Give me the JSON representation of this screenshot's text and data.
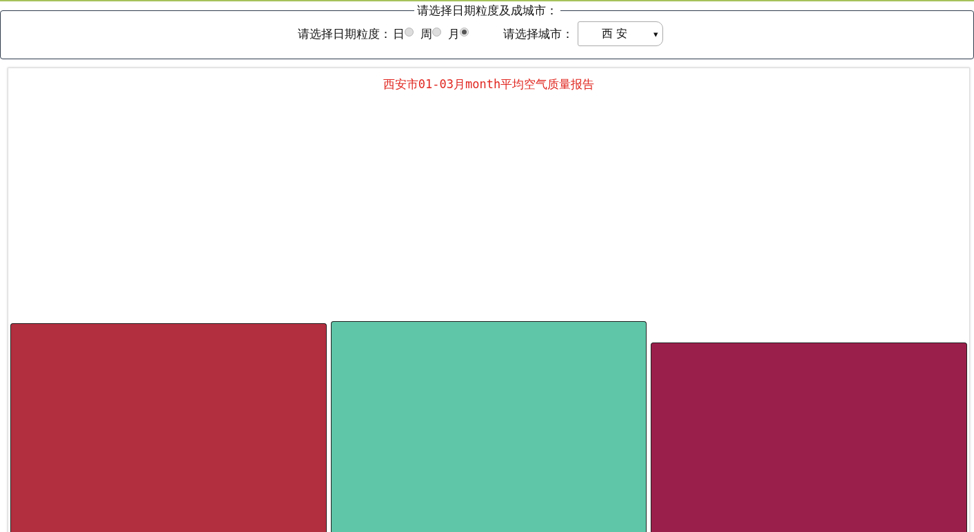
{
  "filter_panel": {
    "legend": "请选择日期粒度及成城市：",
    "granularity_label": "请选择日期粒度：",
    "granularity_options": [
      {
        "label": "日",
        "selected": false
      },
      {
        "label": "周",
        "selected": false
      },
      {
        "label": "月",
        "selected": true
      }
    ],
    "city_label": "请选择城市：",
    "city_select": {
      "value": "西 安",
      "caret": "▾"
    }
  },
  "report": {
    "title": "西安市01-03月month平均空气质量报告",
    "bars": [
      {
        "color": "#b22f40"
      },
      {
        "color": "#5fc6a8"
      },
      {
        "color": "#9a1f4a"
      }
    ]
  }
}
